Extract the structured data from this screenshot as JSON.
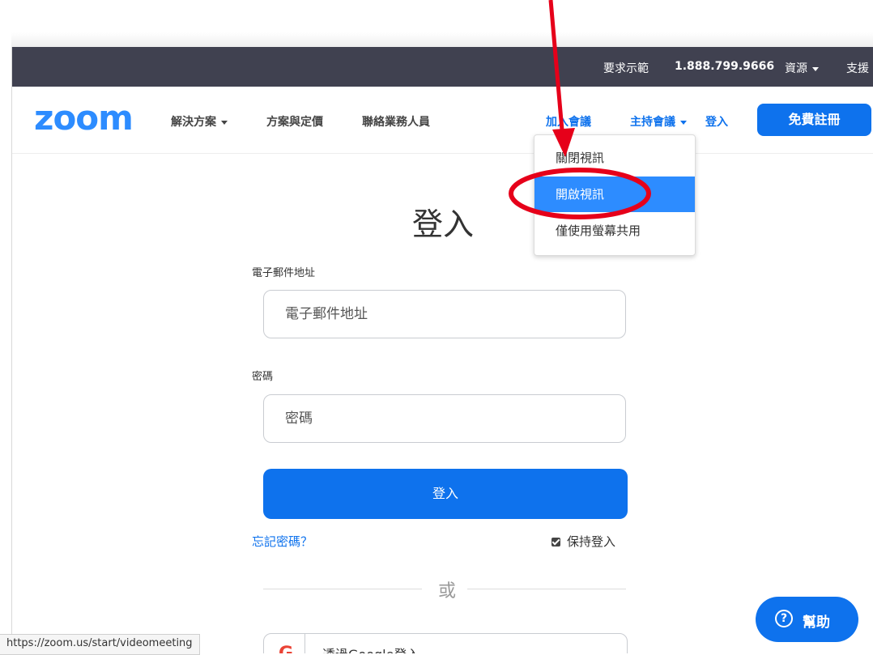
{
  "topbar": {
    "demo": "要求示範",
    "phone": "1.888.799.9666",
    "resources": "資源",
    "support": "支援"
  },
  "nav": {
    "logo": "zoom",
    "solutions": "解決方案",
    "plans": "方案與定價",
    "contact_sales": "聯絡業務人員",
    "join": "加入會議",
    "host": "主持會議",
    "signin": "登入",
    "signup": "免費註冊"
  },
  "host_menu": {
    "items": [
      "關閉視訊",
      "開啟視訊",
      "僅使用螢幕共用"
    ],
    "highlighted_index": 1
  },
  "form": {
    "title": "登入",
    "email_label": "電子郵件地址",
    "email_placeholder": "電子郵件地址",
    "password_label": "密碼",
    "password_placeholder": "密碼",
    "login_button": "登入",
    "forgot": "忘記密碼？",
    "keep_signed_in": "保持登入",
    "or": "或",
    "google": "透過Google登入"
  },
  "help": {
    "label": "幫助"
  },
  "statusbar": {
    "url": "https://zoom.us/start/videomeeting"
  },
  "colors": {
    "accent": "#0e72ed",
    "logo": "#2d8cff",
    "topbar": "#404150",
    "annotation": "#e6001a"
  }
}
